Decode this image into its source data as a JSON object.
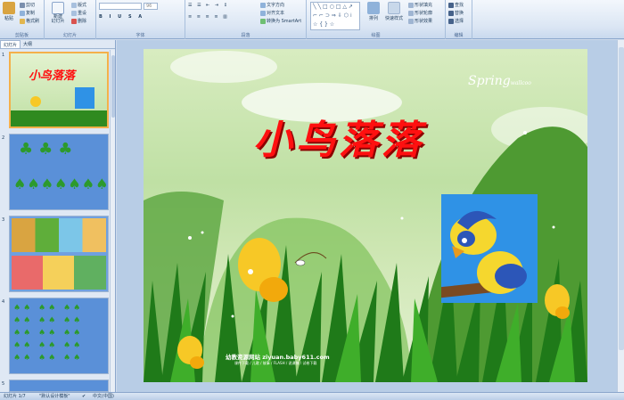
{
  "ribbon": {
    "clipboard": {
      "paste": "粘贴",
      "cut": "剪切",
      "copy": "复制",
      "format_painter": "格式刷",
      "label": "剪贴板"
    },
    "slides": {
      "new_slide": "新建\n幻灯片",
      "layout": "版式",
      "reset": "重设",
      "delete": "删除",
      "label": "幻灯片"
    },
    "font": {
      "size": "96",
      "label": "字体"
    },
    "paragraph": {
      "text_direction": "文字方向",
      "align_text": "对齐文本",
      "smartart": "转换为 SmartArt",
      "label": "段落"
    },
    "drawing": {
      "arrange": "排列",
      "quick_styles": "快速样式",
      "shape_fill": "形状填充",
      "shape_outline": "形状轮廓",
      "shape_effects": "形状效果",
      "label": "绘图"
    },
    "editing": {
      "find": "查找",
      "replace": "替换",
      "select": "选择",
      "label": "编辑"
    }
  },
  "left_panel": {
    "tabs": [
      "幻灯片",
      "大纲"
    ],
    "slide_numbers": [
      "1",
      "2",
      "3",
      "4",
      "5"
    ]
  },
  "slide": {
    "title": "小鸟落落",
    "spring_text": "Spring",
    "spring_small": "wallcoo",
    "watermark": "幼教资源网站 ziyuan.baby611.com",
    "watermark_sub": "课件下载 / 儿歌 / 故事 / FLASH / 说课稿 / 试卷下载"
  },
  "statusbar": {
    "slide_pos": "幻灯片 1/7",
    "theme": "\"默认设计模板\"",
    "language": "中文(中国)"
  },
  "colors": {
    "title_red": "#ff1010",
    "ribbon_blue": "#dbe6f4",
    "selection_orange": "#f4b04a"
  }
}
